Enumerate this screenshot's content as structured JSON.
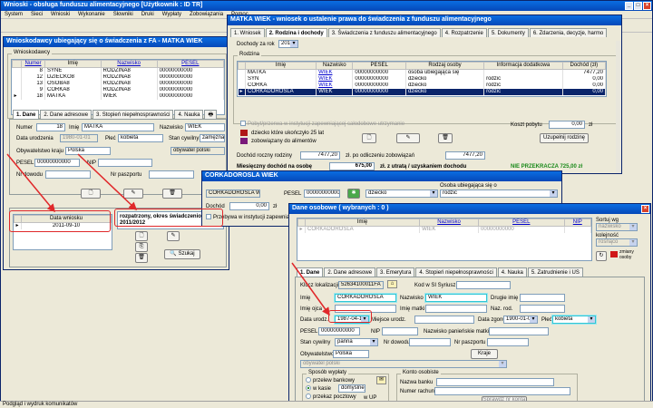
{
  "main": {
    "title": "Wnioski - obsługa funduszu alimentacyjnego [Użytkownik : ID TR]",
    "menu": [
      "System",
      "Sieci",
      "Wnioski",
      "Wykonanie",
      "Słowniki",
      "Druki",
      "Wypłaty",
      "Zobowiązania",
      "Pomoc"
    ],
    "list_title": "Wnioskodawcy ubiegający się o świadczenia z FA - MATKA WIEK",
    "group": "Wnioskodawcy",
    "cols": [
      "Numer",
      "Imię",
      "Nazwisko",
      "PESEL"
    ],
    "rows": [
      [
        "8",
        "SYNE",
        "RODZINA8",
        "00000000000"
      ],
      [
        "12",
        "DZIECKO8",
        "RODZINA8",
        "00000000000"
      ],
      [
        "13",
        "OSOBA8",
        "RODZINA8",
        "00000000000"
      ],
      [
        "9",
        "CORKA8",
        "RODZINA8",
        "00000000000"
      ],
      [
        "18",
        "MATKA",
        "WIEK",
        "00000000000"
      ]
    ],
    "tabs": [
      "1. Dane",
      "2. Dane adresowe",
      "3. Stopień niepełnosprawności",
      "4. Nauka"
    ],
    "numer_label": "Numer",
    "numer": "18",
    "imie_label": "Imię",
    "imie": "MATKA",
    "nazwisko_label": "Nazwisko",
    "nazwisko": "WIEK",
    "data_ur_label": "Data urodzenia",
    "data_ur": "1980-01-01",
    "plec_label": "Płeć",
    "plec": "kobieta",
    "stan_label": "Stan cywilny",
    "stan": "zamężna",
    "obyw_label": "Obywatelstwo kraju",
    "obyw": "Polska",
    "obyw2": "obywatel polski",
    "pesel_label": "PESEL",
    "pesel": "00000000000",
    "nip_label": "NIP",
    "dowod_label": "Nr dowodu",
    "paszport_label": "Nr paszportu",
    "wniosek_col": "Data wniosku",
    "wniosek_val": "2011-09-10",
    "annot": "rozpatrzony, okres świadczeniowy 2011/2012",
    "szukaj": "Szukaj",
    "status": "Podgląd i wydruk komunikatów"
  },
  "matka": {
    "title": "MATKA WIEK - wniosek o ustalenie prawa do świadczenia z funduszu alimentacyjnego",
    "tabs": [
      "1. Wniosek",
      "2. Rodzina i dochody",
      "3. Świadczenia z funduszu alimentacyjnego",
      "4. Rozpatrzenie",
      "5. Dokumenty",
      "6. Zdarzenia, decyzje, harmo"
    ],
    "dochody_label": "Dochody za rok",
    "rok": "2010",
    "group": "Rodzina",
    "cols": [
      "Imię",
      "Nazwisko",
      "PESEL",
      "Rodzaj osoby",
      "Informacja dodatkowa",
      "Dochód (zł)"
    ],
    "rows": [
      [
        "MATKA",
        "WIEK",
        "00000000000",
        "osoba ubiegająca się",
        "",
        "7477,20"
      ],
      [
        "SYN",
        "WIEK",
        "00000000000",
        "dziecko",
        "rodzic",
        "0,00"
      ],
      [
        "CORKA",
        "WIEK",
        "00000000000",
        "dziecko",
        "rodzic",
        "0,00"
      ],
      [
        "CORKADOROSLA",
        "WIEK",
        "00000000000",
        "dziecko",
        "rodzic",
        "0,00"
      ]
    ],
    "check_text": "Pobyt/przerwa w instytucji zapewniającej całodobowe utrzymanie",
    "koszt_label": "Koszt pobytu",
    "koszt": "0,00",
    "zl": "zł",
    "legend1": "dziecko które ukończyło 25 lat",
    "legend2": "zobowiązany do alimentów",
    "uzupelnij": "Uzupełnij rodzinę",
    "roczny_label": "Dochód roczny rodziny",
    "roczny": "7477,20",
    "odlicz_label": "zł. po odliczeniu zobowiązań",
    "odlicz": "7477,20",
    "miesieczny_label": "Miesięczny dochód na osobę",
    "miesieczny": "675,00",
    "utrata": "zł. z utratą / uzyskaniem dochodu",
    "nieprzekracza": "NIE PRZEKRACZA 725,00 zł"
  },
  "corka": {
    "title": "CORKADOROSLA WIEK",
    "name": "CORKADOROSLA WIEK",
    "pesel_label": "PESEL",
    "pesel": "00000000000",
    "rodzaj": "dziecko",
    "osoba_label": "Osoba ubiegająca się o",
    "osoba": "rodzic",
    "dochod_label": "Dochód",
    "dochod": "0,00",
    "zl": "zł",
    "przebywa": "Przebywa w instytucji zapewnia"
  },
  "dane": {
    "title": "Dane osobowe ( wybranych : 0 )",
    "cols": [
      "Imię",
      "Nazwisko",
      "PESEL",
      "NIP"
    ],
    "row": [
      "CORKADOROSLA",
      "WIEK",
      "00000000000",
      ""
    ],
    "sortuj": "Sortuj wg",
    "sort_val": "nazwisko",
    "kolejnosc": "kolejność",
    "kol_val": "rosnąco",
    "zmiany": "zmiany osoby",
    "tabs": [
      "1. Dane",
      "2. Dane adresowe",
      "3. Emerytura",
      "4. Stopień niepełnosprawności",
      "4. Nauka",
      "5. Zatrudnienie i US"
    ],
    "klucz_label": "Klucz lokalizacji",
    "klucz": "52634100011FA",
    "kod_label": "Kod w SI Syriusz",
    "imie_label": "Imię",
    "imie": "CORKADOROSLA",
    "nazwisko_label": "Nazwisko",
    "nazwisko": "WIEK",
    "drugie_label": "Drugie imię",
    "ojca_label": "Imię ojca",
    "matki_label": "Imię matki",
    "nazrod_label": "Naz. rod.",
    "data_ur_label": "Data urodz.",
    "data_ur": "1987-04-15",
    "miejsce_label": "Miejsce urodz.",
    "zgonu_label": "Data zgonu",
    "zgonu": "1900-01-01",
    "plec_label": "Płeć",
    "plec": "kobieta",
    "pesel_label": "PESEL",
    "pesel": "00000000000",
    "nip_label": "NIP",
    "panienskie_label": "Nazwisko panieńskie matki",
    "stan_label": "Stan cywilny",
    "stan": "panna",
    "dowod_label": "Nr dowodu",
    "paszport_label": "Nr paszportu",
    "obyw_label": "Obywatelstwo kraju",
    "obyw": "Polska",
    "kraje": "Kraje",
    "obyw2": "obywatel polski",
    "wyplaty": "Sposób wypłaty",
    "bank": "przelew bankowy",
    "kasie": "w kasie",
    "kasie_val": "domyślnej",
    "poczta": "przekaz pocztowy",
    "up": "w UP",
    "konto": "Konto osobiste",
    "bank_label": "Nazwa banku",
    "rachunek_label": "Numer rachunku",
    "sprawdz": "Sprawdź nr konta"
  }
}
